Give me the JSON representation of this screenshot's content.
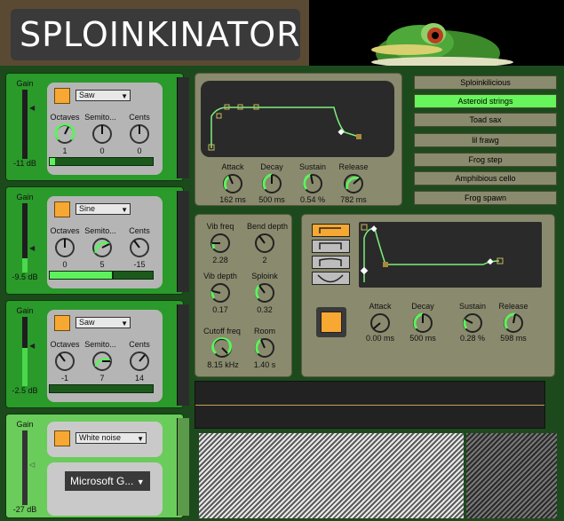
{
  "title": "SPLOINKINATOR",
  "oscillators": [
    {
      "gain_label": "Gain",
      "gain_db": "-11 dB",
      "gain_level": 0.0,
      "wave": "Saw",
      "octaves_label": "Octaves",
      "semitones_label": "Semito...",
      "cents_label": "Cents",
      "octaves": "1",
      "semitones": "0",
      "cents": "0",
      "bar_level": 0.05
    },
    {
      "gain_label": "Gain",
      "gain_db": "-9.5 dB",
      "gain_level": 0.2,
      "wave": "Sine",
      "octaves_label": "Octaves",
      "semitones_label": "Semito...",
      "cents_label": "Cents",
      "octaves": "0",
      "semitones": "5",
      "cents": "-15",
      "bar_level": 0.6
    },
    {
      "gain_label": "Gain",
      "gain_db": "-2.5 dB",
      "gain_level": 0.55,
      "wave": "Saw",
      "octaves_label": "Octaves",
      "semitones_label": "Semito...",
      "cents_label": "Cents",
      "octaves": "-1",
      "semitones": "7",
      "cents": "14",
      "bar_level": 0.0
    }
  ],
  "noise": {
    "gain_label": "Gain",
    "gain_db": "-27 dB",
    "wave": "White noise",
    "device": "Microsoft G..."
  },
  "env1": {
    "attack_label": "Attack",
    "decay_label": "Decay",
    "sustain_label": "Sustain",
    "release_label": "Release",
    "attack": "162 ms",
    "decay": "500 ms",
    "sustain": "0.54 %",
    "release": "782 ms"
  },
  "presets": [
    "Sploinkilicious",
    "Asteroid strings",
    "Toad sax",
    "lil frawg",
    "Frog step",
    "Amphibious cello",
    "Frog spawn"
  ],
  "active_preset": 1,
  "mod": {
    "vib_freq_label": "Vib freq",
    "bend_depth_label": "Bend depth",
    "vib_depth_label": "Vib depth",
    "sploink_label": "Sploink",
    "cutoff_label": "Cutoff freq",
    "room_label": "Room",
    "vib_freq": "2.28",
    "bend_depth": "2",
    "vib_depth": "0.17",
    "sploink": "0.32",
    "cutoff": "8.15 kHz",
    "room": "1.40 s"
  },
  "env2": {
    "attack_label": "Attack",
    "decay_label": "Decay",
    "sustain_label": "Sustain",
    "release_label": "Release",
    "attack": "0.00 ms",
    "decay": "500 ms",
    "sustain": "0.28 %",
    "release": "598 ms"
  },
  "colors": {
    "accent": "#f7a832",
    "green": "#66f55a",
    "panel": "#8a8a6e"
  }
}
